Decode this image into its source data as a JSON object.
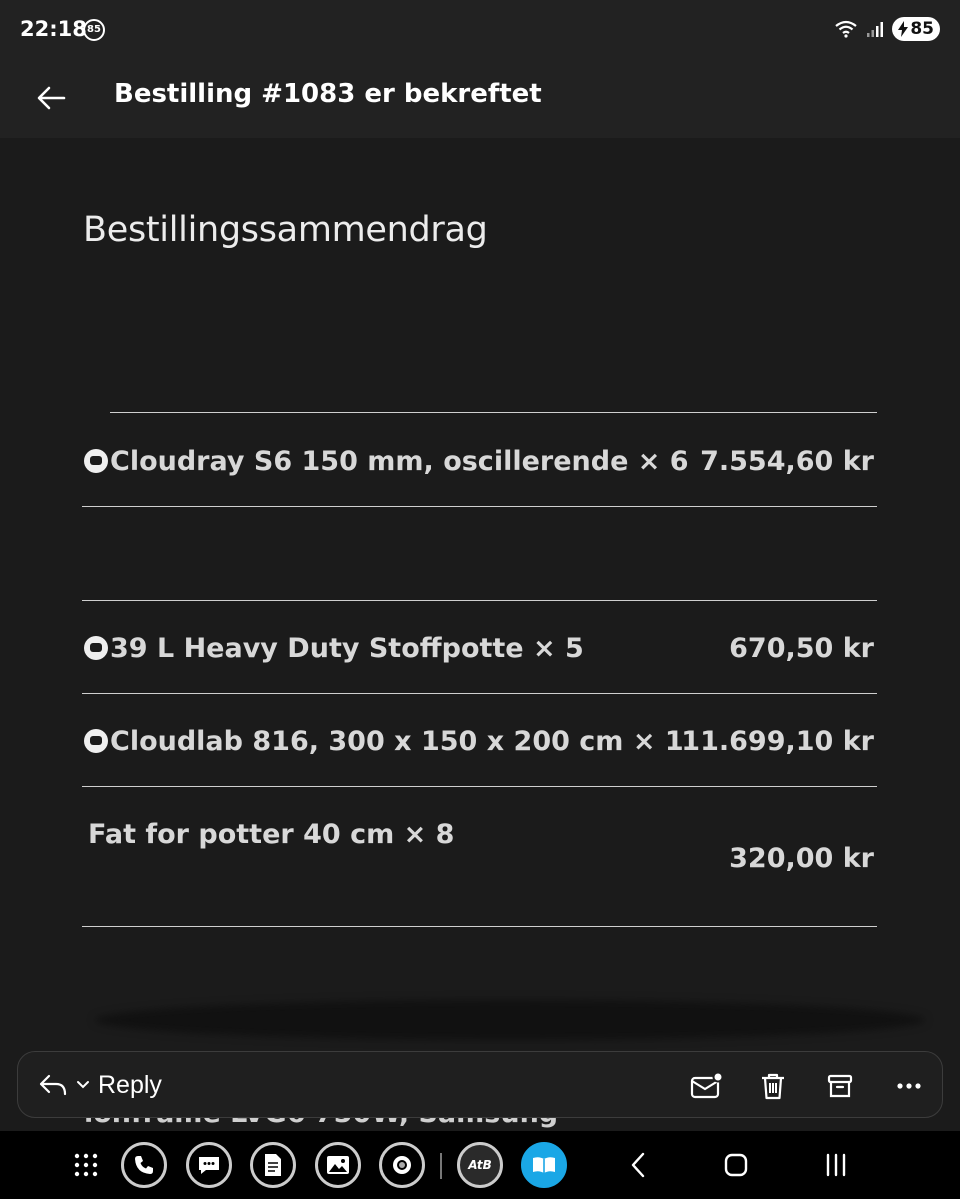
{
  "status_bar": {
    "time": "22:18",
    "notification_badge": "85",
    "battery_level": "85"
  },
  "app_bar": {
    "title": "Bestilling #1083 er bekreftet"
  },
  "summary": {
    "heading": "Bestillingssammendrag",
    "items": [
      {
        "name": "Cloudray S6 150 mm, oscillerende × 6",
        "price": "7.554,60 kr",
        "icon": "product-thumbnail-icon"
      },
      {
        "name": "39 L Heavy Duty Stoffpotte × 5",
        "price": "670,50 kr",
        "icon": "product-thumbnail-icon"
      },
      {
        "name": "Cloudlab 816, 300 x 150 x 200 cm × 1",
        "price": "11.699,10 kr",
        "icon": "product-thumbnail-icon"
      },
      {
        "name": "Fat for potter 40 cm × 8",
        "price": "320,00 kr"
      }
    ],
    "cut_off_item_fragment": "lonframe LVG6 750W, Samsung"
  },
  "reply_bar": {
    "reply_label": "Reply",
    "actions": [
      "mark-unread-icon",
      "delete-icon",
      "archive-icon",
      "more-icon"
    ]
  },
  "nav_bar": {
    "apps": [
      "phone-icon",
      "messages-icon",
      "notes-icon",
      "gallery-icon",
      "camera-icon",
      "atb-icon",
      "reader-icon"
    ],
    "atb_label": "AtB",
    "system": [
      "back-icon",
      "home-icon",
      "recents-icon"
    ]
  }
}
